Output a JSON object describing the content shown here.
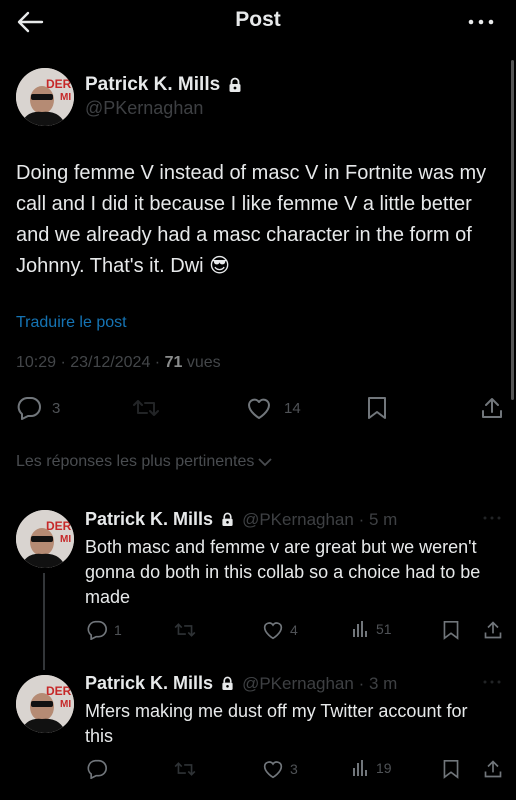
{
  "header": {
    "title": "Post",
    "back_icon": "arrow-left-icon",
    "more_icon": "more-horizontal-icon"
  },
  "tweet": {
    "author": "Patrick K. Mills",
    "handle": "@PKernaghan",
    "text": "Doing femme V instead of masc V in Fortnite was my call and I did it because I like femme V a little better and we already had a masc character in the form of Johnny. That's it. Dwi 😎",
    "translate": "Traduire le post",
    "timestamp": "10:29 · 23/12/2024 ·",
    "views_count": "71",
    "views_label": "vues",
    "replies": "3",
    "likes": "14"
  },
  "sort_label": "Les réponses les plus pertinentes",
  "replies": [
    {
      "author": "Patrick K. Mills",
      "handle": "@PKernaghan · 5 m",
      "text": "Both masc and femme v are great but we weren't gonna do both in this collab so a choice had to be made",
      "replies": "1",
      "likes": "4",
      "views": "51"
    },
    {
      "author": "Patrick K. Mills",
      "handle": "@PKernaghan · 3 m",
      "text": "Mfers making me dust off my Twitter account for this",
      "replies": "",
      "likes": "3",
      "views": "19"
    }
  ],
  "colors": {
    "background": "#000000",
    "text": "#e7e9ea",
    "muted": "#71767b",
    "link": "#1d9bf0"
  }
}
